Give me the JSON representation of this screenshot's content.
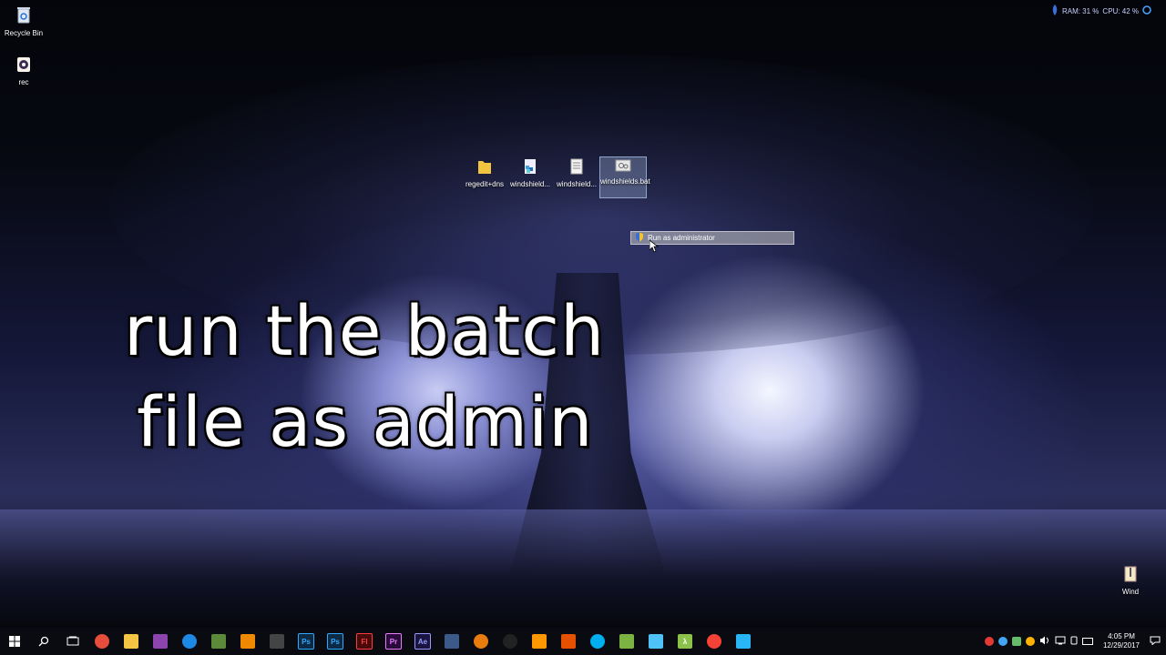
{
  "desktop": {
    "icons_left": [
      {
        "label": "Recycle Bin",
        "icon": "recycle-bin-icon"
      },
      {
        "label": "rec",
        "icon": "obs-recorder-icon"
      }
    ],
    "icons_center": [
      {
        "label": "regedit+dns",
        "icon": "folder-icon"
      },
      {
        "label": "windshield...",
        "icon": "registry-file-icon"
      },
      {
        "label": "windshield...",
        "icon": "text-file-icon"
      },
      {
        "label": "windshields.bat",
        "icon": "batch-file-icon",
        "selected": true
      }
    ],
    "icon_right": {
      "label": "Wind",
      "icon": "archive-file-icon"
    }
  },
  "context_menu": {
    "item": "Run as administrator",
    "icon": "uac-shield-icon"
  },
  "overlay_caption": {
    "line1": "run the batch",
    "line2": "file as admin"
  },
  "perf_monitor": {
    "ram": "RAM: 31 %",
    "cpu": "CPU: 42 %"
  },
  "taskbar": {
    "apps": [
      {
        "name": "Chrome",
        "icon": "chrome-icon",
        "color": "#e74c3c"
      },
      {
        "name": "File Explorer",
        "icon": "folder-icon",
        "color": "#f4c542"
      },
      {
        "name": "Media Player",
        "icon": "media-icon",
        "color": "#8e44ad"
      },
      {
        "name": "Edge",
        "icon": "edge-icon",
        "color": "#1e88e5"
      },
      {
        "name": "Minecraft",
        "icon": "minecraft-icon",
        "color": "#5d8a3a"
      },
      {
        "name": "VLC",
        "icon": "vlc-icon",
        "color": "#f08a00"
      },
      {
        "name": "Video Editor",
        "icon": "film-icon",
        "color": "#444"
      },
      {
        "name": "Ps",
        "icon": "photoshop-icon",
        "color": "#0b2a45",
        "text": "Ps"
      },
      {
        "name": "Ps",
        "icon": "photoshop-icon",
        "color": "#0b2a45",
        "text": "Ps"
      },
      {
        "name": "Fl",
        "icon": "flash-icon",
        "color": "#4a0a0a",
        "text": "Fl"
      },
      {
        "name": "Pr",
        "icon": "premiere-icon",
        "color": "#2a0a3a",
        "text": "Pr"
      },
      {
        "name": "Ae",
        "icon": "aftereffects-icon",
        "color": "#1a1440",
        "text": "Ae"
      },
      {
        "name": "Editor",
        "icon": "editor-icon",
        "color": "#3b5a8a"
      },
      {
        "name": "Blender",
        "icon": "blender-icon",
        "color": "#e87d0d"
      },
      {
        "name": "Unity",
        "icon": "unity-icon",
        "color": "#222"
      },
      {
        "name": "Sublime",
        "icon": "sublime-icon",
        "color": "#ff9800"
      },
      {
        "name": "Flame",
        "icon": "flame-icon",
        "color": "#e65100"
      },
      {
        "name": "Skype",
        "icon": "skype-icon",
        "color": "#00aff0"
      },
      {
        "name": "Notepad++",
        "icon": "notepad-icon",
        "color": "#7cb342"
      },
      {
        "name": "App",
        "icon": "app-icon",
        "color": "#4fc3f7"
      },
      {
        "name": "Lambda",
        "icon": "lambda-icon",
        "color": "#8bc34a",
        "text": "λ"
      },
      {
        "name": "Browser",
        "icon": "browser-icon",
        "color": "#f44336"
      },
      {
        "name": "Remote",
        "icon": "remote-icon",
        "color": "#29b6f6"
      }
    ],
    "clock_time": "4:05 PM",
    "clock_date": "12/29/2017"
  }
}
